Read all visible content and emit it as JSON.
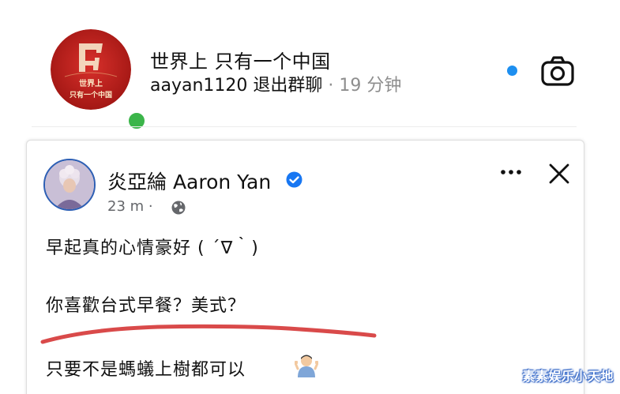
{
  "chat": {
    "name": "世界上 只有一个中国",
    "sender": "aayan1120",
    "action": "退出群聊",
    "separator": " · ",
    "time": "19 分钟",
    "avatar_badge_text": "世界上\n只有一个中国",
    "online_color": "#3bb54a",
    "unread_color": "#1d8ff0",
    "icons": {
      "camera": "camera-icon"
    }
  },
  "post": {
    "author": "炎亞綸 Aaron Yan",
    "time": "23 m",
    "meta_separator": " · ",
    "lines": [
      "早起真的心情豪好 ( ´∇｀)",
      "你喜歡台式早餐？美式？",
      "只要不是螞蟻上樹都可以"
    ],
    "icons": {
      "verified": "verified-badge-icon",
      "audience": "globe-icon",
      "more": "more-options-icon",
      "close": "close-icon",
      "emoji": "shrug-emoji-icon"
    },
    "highlight_color": "#d94a4a"
  },
  "watermark": {
    "text": "素素娱乐小天地"
  }
}
